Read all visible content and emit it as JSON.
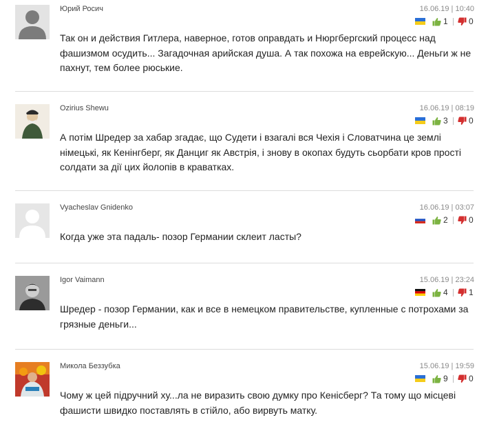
{
  "comments": [
    {
      "author": "Юрий Росич",
      "date": "16.06.19 | 10:40",
      "flag": "ukraine-flag",
      "likes": "1",
      "dislikes": "0",
      "text": "Так он и действия Гитлера, наверное, готов оправдать и Нюргбергский процесс над фашизмом осудить... Загадочная арийская душа. А так похожа на еврейскую... Деньги ж не пахнут, тем более рюськие.",
      "avatar": "default-avatar-icon"
    },
    {
      "author": "Ozirius Shewu",
      "date": "16.06.19 | 08:19",
      "flag": "ukraine-flag",
      "likes": "3",
      "dislikes": "0",
      "text": "А потім Шредер за хабар згадає, що Судети і взагалі вся Чехія і Словатчина це землі німецькі, як Кенінгберг, як Данциг як Австрія, і знову в окопах будуть сьорбати кров прості солдати за дії цих йолопів в краватках.",
      "avatar": "user-photo-avatar"
    },
    {
      "author": "Vyacheslav Gnidenko",
      "date": "16.06.19 | 03:07",
      "flag": "russia-flag",
      "likes": "2",
      "dislikes": "0",
      "text": "Когда уже эта падаль- позор Германии склеит ласты?",
      "avatar": "default-avatar-icon"
    },
    {
      "author": "Igor Vaimann",
      "date": "15.06.19 | 23:24",
      "flag": "germany-flag",
      "likes": "4",
      "dislikes": "1",
      "text": "Шредер - позор Германии, как и все в немецком правительстве, купленные с потрохами за грязные деньги...",
      "avatar": "user-photo-avatar"
    },
    {
      "author": "Микола Беззубка",
      "date": "15.06.19 | 19:59",
      "flag": "ukraine-flag",
      "likes": "9",
      "dislikes": "0",
      "text": "Чому ж цей підручний ху...ла не виразить свою думку про Кенісберг? Та тому що місцеві фашисти швидко поставлять в стійло, або вирвуть матку.",
      "avatar": "user-photo-avatar"
    }
  ],
  "colors": {
    "like": "#7cb342",
    "dislike": "#d32f2f",
    "divider": "#dcdcdc",
    "meta": "#8a8a8a"
  }
}
